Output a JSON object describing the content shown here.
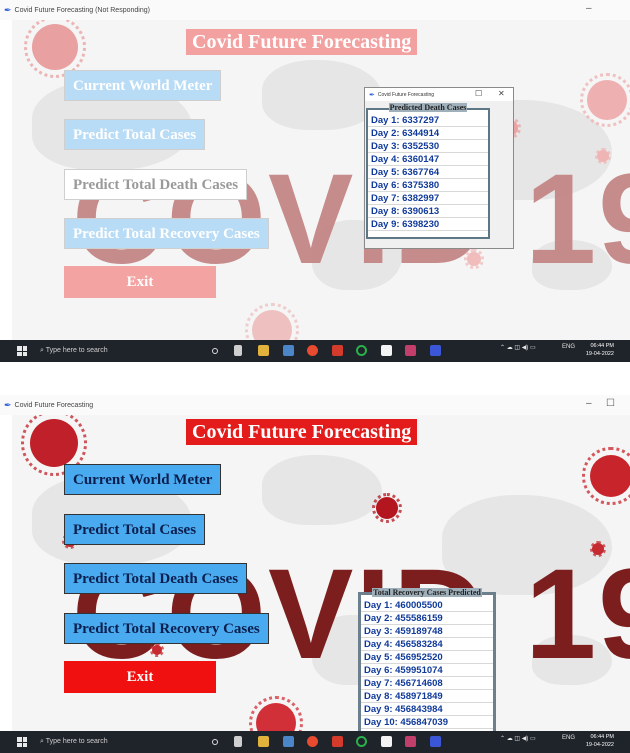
{
  "top": {
    "window_title": "Covid Future Forecasting (Not Responding)",
    "app_title": "Covid Future Forecasting",
    "background_word": "COVID 19",
    "menu": {
      "world_meter": "Current World Meter",
      "total_cases": "Predict Total Cases",
      "death_cases": "Predict Total Death Cases",
      "recovery_cases": "Predict Total Recovery Cases",
      "exit": "Exit"
    },
    "popup": {
      "title": "Covid Future Forecasting",
      "group_title": "Predicted Death Cases",
      "rows": [
        "Day 1: 6337297",
        "Day 2: 6344914",
        "Day 3: 6352530",
        "Day 4: 6360147",
        "Day 5: 6367764",
        "Day 6: 6375380",
        "Day 7: 6382997",
        "Day 8: 6390613",
        "Day 9: 6398230"
      ]
    }
  },
  "bottom": {
    "window_title": "Covid Future Forecasting",
    "app_title": "Covid Future Forecasting",
    "background_word": "COVID 19",
    "menu": {
      "world_meter": "Current World Meter",
      "total_cases": "Predict Total Cases",
      "death_cases": "Predict Total Death Cases",
      "recovery_cases": "Predict Total Recovery Cases",
      "exit": "Exit"
    },
    "panel": {
      "group_title": "Total Recovery Cases Predicted",
      "rows": [
        "Day 1: 460005500",
        "Day 2: 455586159",
        "Day 3: 459189748",
        "Day 4: 456583284",
        "Day 5: 456952520",
        "Day 6: 459951074",
        "Day 7: 456714608",
        "Day 8: 458971849",
        "Day 9: 456843984",
        "Day 10: 456847039"
      ]
    }
  },
  "taskbar": {
    "search_placeholder": "Type here to search",
    "lang": "ENG",
    "time": "06:44 PM",
    "date": "19-04-2022"
  },
  "colors": {
    "title_bg_faded": "#f3a0a0",
    "title_bg": "#e31b1b",
    "button_bg": "#4aaaf0",
    "button_bg_faded": "#b9dcf6",
    "exit_bg": "#f01010",
    "exit_bg_faded": "#f4a3a3",
    "row_text": "#103a9a"
  },
  "icons": [
    "feather-icon",
    "windows-start-icon",
    "search-icon",
    "virus-icon",
    "minimize-icon",
    "maximize-icon",
    "close-icon"
  ]
}
